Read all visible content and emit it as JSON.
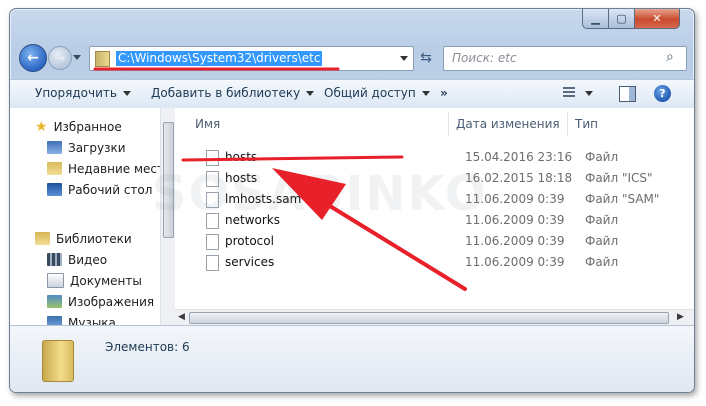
{
  "window": {
    "controls": {
      "minimize_icon": "minimize-icon",
      "maximize_icon": "maximize-icon",
      "close_icon": "close-icon"
    }
  },
  "navigation": {
    "address": "C:\\Windows\\System32\\drivers\\etc",
    "search_placeholder": "Поиск: etc"
  },
  "toolbar": {
    "organize": "Упорядочить",
    "library": "Добавить в библиотеку",
    "share": "Общий доступ",
    "more": "»"
  },
  "sidebar": {
    "favorites_header": "Избранное",
    "favorites": [
      {
        "label": "Загрузки"
      },
      {
        "label": "Недавние места"
      },
      {
        "label": "Рабочий стол"
      }
    ],
    "libraries_header": "Библиотеки",
    "libraries": [
      {
        "label": "Видео"
      },
      {
        "label": "Документы"
      },
      {
        "label": "Изображения"
      },
      {
        "label": "Музыка"
      }
    ]
  },
  "file_list": {
    "columns": {
      "name": "Имя",
      "date": "Дата изменения",
      "type": "Тип"
    },
    "files": [
      {
        "name": "hosts",
        "date": "15.04.2016 23:16",
        "type": "Файл"
      },
      {
        "name": "hosts",
        "date": "16.02.2015 18:18",
        "type": "Файл \"ICS\""
      },
      {
        "name": "lmhosts.sam",
        "date": "11.06.2009 0:39",
        "type": "Файл \"SAM\""
      },
      {
        "name": "networks",
        "date": "11.06.2009 0:39",
        "type": "Файл"
      },
      {
        "name": "protocol",
        "date": "11.06.2009 0:39",
        "type": "Файл"
      },
      {
        "name": "services",
        "date": "11.06.2009 0:39",
        "type": "Файл"
      }
    ]
  },
  "status": {
    "items": "Элементов: 6"
  },
  "overlay": {
    "watermark": "SOSABINKO",
    "annotation_color": "#e8202a"
  }
}
